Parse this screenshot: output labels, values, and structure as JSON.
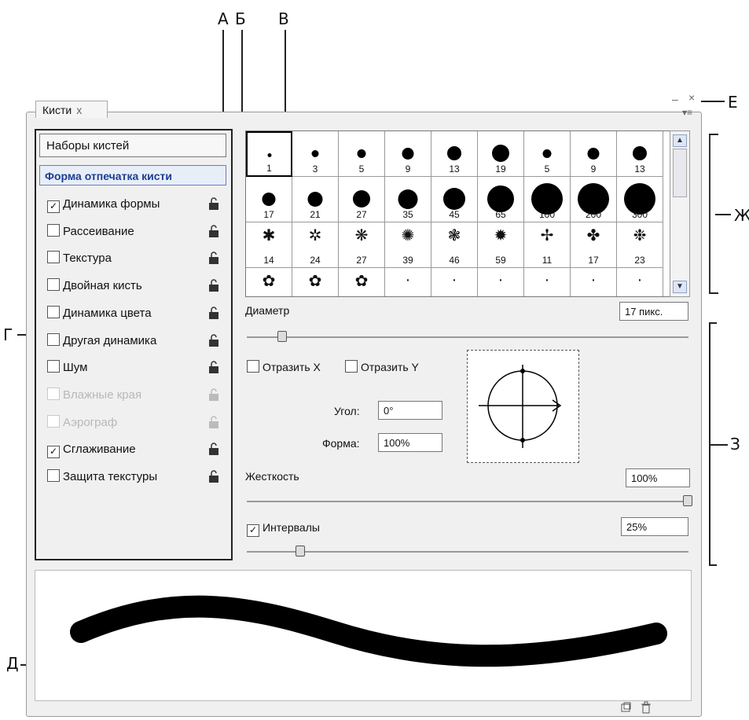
{
  "callouts": {
    "a": "А",
    "b": "Б",
    "v": "В",
    "e": "Е",
    "zh": "Ж",
    "g": "Г",
    "z": "З",
    "d": "Д"
  },
  "tab": {
    "title": "Кисти",
    "close": "x"
  },
  "window_buttons": {
    "minimize": "–",
    "close": "×",
    "menu": "▾≡"
  },
  "left": {
    "presets": "Наборы кистей",
    "tip_shape": "Форма отпечатка кисти",
    "options": [
      {
        "label": "Динамика формы",
        "check": "✓",
        "enabled": true
      },
      {
        "label": "Рассеивание",
        "check": "",
        "enabled": true
      },
      {
        "label": "Текстура",
        "check": "",
        "enabled": true
      },
      {
        "label": "Двойная кисть",
        "check": "",
        "enabled": true
      },
      {
        "label": "Динамика цвета",
        "check": "",
        "enabled": true
      },
      {
        "label": "Другая динамика",
        "check": "",
        "enabled": true
      },
      {
        "label": "Шум",
        "check": "",
        "enabled": true
      },
      {
        "label": "Влажные края",
        "check": "",
        "enabled": false
      },
      {
        "label": "Аэрограф",
        "check": "",
        "enabled": false
      },
      {
        "label": "Сглаживание",
        "check": "✓",
        "enabled": true
      },
      {
        "label": "Защита текстуры",
        "check": "",
        "enabled": true
      }
    ]
  },
  "brushes": {
    "row1": [
      "1",
      "3",
      "5",
      "9",
      "13",
      "19",
      "5",
      "9",
      "13"
    ],
    "row2": [
      "17",
      "21",
      "27",
      "35",
      "45",
      "65",
      "100",
      "200",
      "300"
    ],
    "row3": [
      "14",
      "24",
      "27",
      "39",
      "46",
      "59",
      "11",
      "17",
      "23"
    ]
  },
  "controls": {
    "diameter_label": "Диаметр",
    "diameter_value": "17 пикс.",
    "flip_x": "Отразить X",
    "flip_y": "Отразить Y",
    "angle_label": "Угол:",
    "angle_value": "0°",
    "roundness_label": "Форма:",
    "roundness_value": "100%",
    "hardness_label": "Жесткость",
    "hardness_value": "100%",
    "spacing_label": "Интервалы",
    "spacing_check": "✓",
    "spacing_value": "25%"
  },
  "colors": {
    "accent": "#1c3f8f",
    "selected_row": "#e8eef8"
  }
}
